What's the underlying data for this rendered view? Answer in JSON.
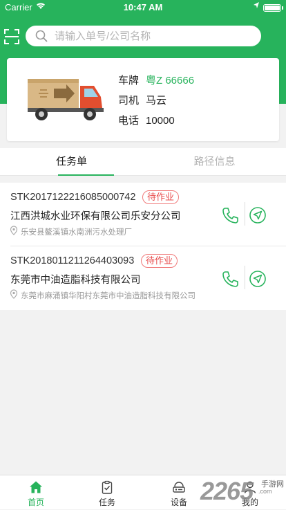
{
  "status_bar": {
    "carrier": "Carrier",
    "time": "10:47 AM"
  },
  "search": {
    "placeholder": "请输入单号/公司名称",
    "value": ""
  },
  "vehicle": {
    "plate_label": "车牌",
    "plate_value": "粤Z 66666",
    "driver_label": "司机",
    "driver_value": "马云",
    "phone_label": "电话",
    "phone_value": "10000"
  },
  "tabs": [
    {
      "label": "任务单",
      "active": true
    },
    {
      "label": "路径信息",
      "active": false
    }
  ],
  "tasks": [
    {
      "order_no": "STK2017122216085000742",
      "status": "待作业",
      "company": "江西洪城水业环保有限公司乐安分公司",
      "address": "乐安县鳌溪镇水南洲污水处理厂"
    },
    {
      "order_no": "STK2018011211264403093",
      "status": "待作业",
      "company": "东莞市中油造脂科技有限公司",
      "address": "东莞市麻涌镇华阳村东莞市中油造脂科技有限公司"
    }
  ],
  "tabbar": [
    {
      "label": "首页",
      "icon": "home-icon",
      "active": true
    },
    {
      "label": "任务",
      "icon": "clipboard-check-icon",
      "active": false
    },
    {
      "label": "设备",
      "icon": "device-icon",
      "active": false
    },
    {
      "label": "我的",
      "icon": "user-icon",
      "active": false
    }
  ],
  "watermark": {
    "number": "2265",
    "site": "手游网",
    "url": ".com"
  },
  "colors": {
    "primary": "#27b35c",
    "status_badge": "#e84c4c",
    "muted_text": "#999999"
  }
}
